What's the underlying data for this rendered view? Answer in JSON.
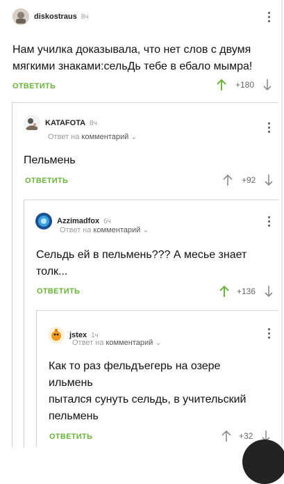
{
  "colors": {
    "accent_green": "#69b23b",
    "text": "#111111",
    "muted": "#9b9b9b",
    "border": "#cfcfcf"
  },
  "comments": [
    {
      "author": "diskostraus",
      "time": "8ч",
      "text": "Нам училка доказывала, что нет слов с двумя мягкими знаками:сельДь тебе в ебало мымра!",
      "reply_label": "ОТВЕТИТЬ",
      "rating": "+180",
      "upvoted": true
    },
    {
      "author": "KATAFOTA",
      "time": "8ч",
      "reply_prefix": "Ответ на",
      "reply_target": "комментарий",
      "text": "Пельмень",
      "reply_label": "ОТВЕТИТЬ",
      "rating": "+92",
      "upvoted": false
    },
    {
      "author": "Azzimadfox",
      "time": "6ч",
      "reply_prefix": "Ответ на",
      "reply_target": "комментарий",
      "text_lines": [
        "Сельдь ей в пельмень??? А месье знает",
        "толк..."
      ],
      "reply_label": "ОТВЕТИТЬ",
      "rating": "+136",
      "upvoted": true
    },
    {
      "author": "jstex",
      "time": "1ч",
      "reply_prefix": "Ответ на",
      "reply_target": "комментарий",
      "text_lines": [
        "Как то раз фельдъегерь на озере",
        "ильмень",
        "пытался сунуть сельдь, в учительский",
        "пельмень"
      ],
      "reply_label": "ОТВЕТИТЬ",
      "rating": "+32",
      "upvoted": false
    }
  ]
}
